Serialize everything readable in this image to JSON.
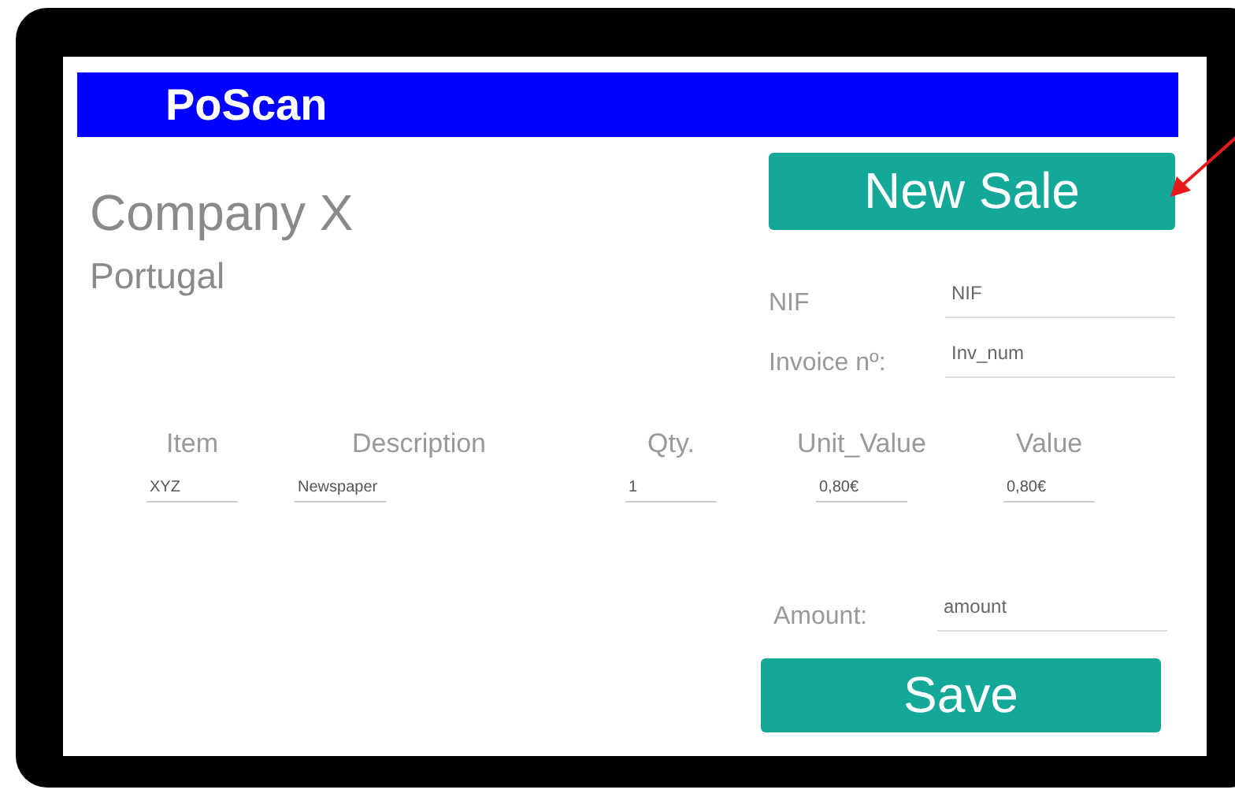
{
  "app_bar": {
    "title": "PoScan"
  },
  "company": {
    "name": "Company X",
    "country": "Portugal"
  },
  "new_sale_button": "New Sale",
  "fields": [
    {
      "label": "NIF",
      "placeholder": "NIF"
    },
    {
      "label": "Invoice nº:",
      "placeholder": "Inv_num"
    }
  ],
  "table": {
    "columns": [
      "Item",
      "Description",
      "Qty.",
      "Unit_Value",
      "Value"
    ],
    "rows": [
      [
        "XYZ",
        "Newspaper",
        "1",
        "0,80€",
        "0,80€"
      ]
    ]
  },
  "amount": {
    "label": "Amount:",
    "placeholder": "amount"
  },
  "save_button": "Save"
}
